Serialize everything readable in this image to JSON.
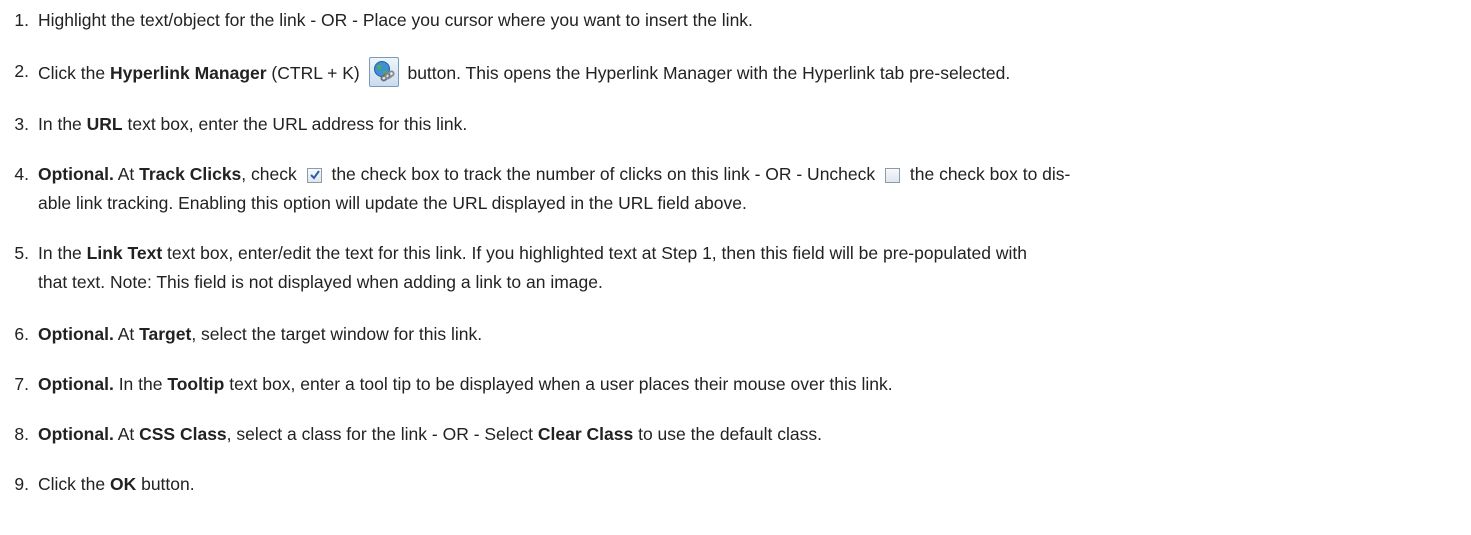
{
  "steps": [
    {
      "number": "1.",
      "text": "Highlight the text/object for the link - OR - Place you cursor where you want to insert the link."
    },
    {
      "number": "2.",
      "pre": "Click the ",
      "bold1": "Hyperlink Manager",
      "mid": " (CTRL + K) ",
      "icon": "hyperlink-manager-icon",
      "post": " button. This opens the Hyperlink Manager with the Hyperlink tab pre-selected."
    },
    {
      "number": "3.",
      "pre": "In the ",
      "bold1": "URL",
      "post": " text box, enter the URL address for this link."
    },
    {
      "number": "4.",
      "bold1": "Optional.",
      "a": " At ",
      "bold2": "Track Clicks",
      "b": ", check ",
      "checked_icon": "checked-checkbox-icon",
      "c": " the check box to track the number of clicks on this link - OR - Uncheck ",
      "unchecked_icon": "unchecked-checkbox-icon",
      "d": " the check box to dis-",
      "line2": "able link tracking. Enabling this option will update the URL displayed in the URL field above."
    },
    {
      "number": "5.",
      "pre": "In the ",
      "bold1": "Link Text",
      "post": " text box, enter/edit the text for this link. If you highlighted text at Step 1, then this field will be pre-populated with",
      "line2": "that text. Note: This field is not displayed when adding a link to an image."
    },
    {
      "number": "6.",
      "bold1": "Optional.",
      "a": " At ",
      "bold2": "Target",
      "b": ", select the target window for this link."
    },
    {
      "number": "7.",
      "bold1": "Optional.",
      "a": " In the ",
      "bold2": "Tooltip",
      "b": " text box, enter a tool tip to be displayed when a user places their mouse over this link."
    },
    {
      "number": "8.",
      "bold1": "Optional.",
      "a": " At ",
      "bold2": "CSS Class",
      "b": ", select a class for the link - OR - Select ",
      "bold3": "Clear Class",
      "c": " to use the default class."
    },
    {
      "number": "9.",
      "pre": "Click the ",
      "bold1": "OK",
      "post": " button."
    }
  ]
}
